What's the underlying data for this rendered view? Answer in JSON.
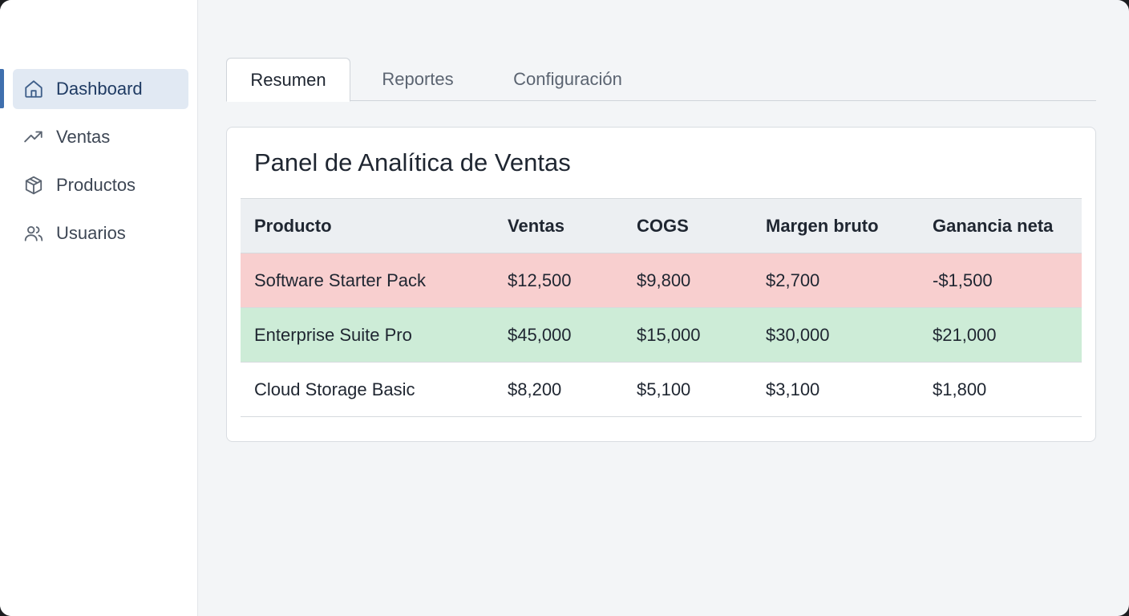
{
  "sidebar": {
    "items": [
      {
        "label": "Dashboard",
        "icon": "home-icon",
        "active": true
      },
      {
        "label": "Ventas",
        "icon": "trending-up-icon",
        "active": false
      },
      {
        "label": "Productos",
        "icon": "box-icon",
        "active": false
      },
      {
        "label": "Usuarios",
        "icon": "users-icon",
        "active": false
      }
    ]
  },
  "tabs": [
    {
      "label": "Resumen",
      "active": true
    },
    {
      "label": "Reportes",
      "active": false
    },
    {
      "label": "Configuración",
      "active": false
    }
  ],
  "card": {
    "title": "Panel de Analítica de Ventas"
  },
  "table": {
    "headers": [
      "Producto",
      "Ventas",
      "COGS",
      "Margen bruto",
      "Ganancia neta"
    ],
    "rows": [
      {
        "cells": [
          "Software Starter Pack",
          "$12,500",
          "$9,800",
          "$2,700",
          "-$1,500"
        ],
        "status": "loss"
      },
      {
        "cells": [
          "Enterprise Suite Pro",
          "$45,000",
          "$15,000",
          "$30,000",
          "$21,000"
        ],
        "status": "profit"
      },
      {
        "cells": [
          "Cloud Storage Basic",
          "$8,200",
          "$5,100",
          "$3,100",
          "$1,800"
        ],
        "status": "neutral"
      }
    ]
  },
  "colors": {
    "accent": "#3f6fae",
    "active_nav_bg": "#e1e9f3",
    "loss_row": "#f8cfcf",
    "profit_row": "#cdecd7"
  }
}
